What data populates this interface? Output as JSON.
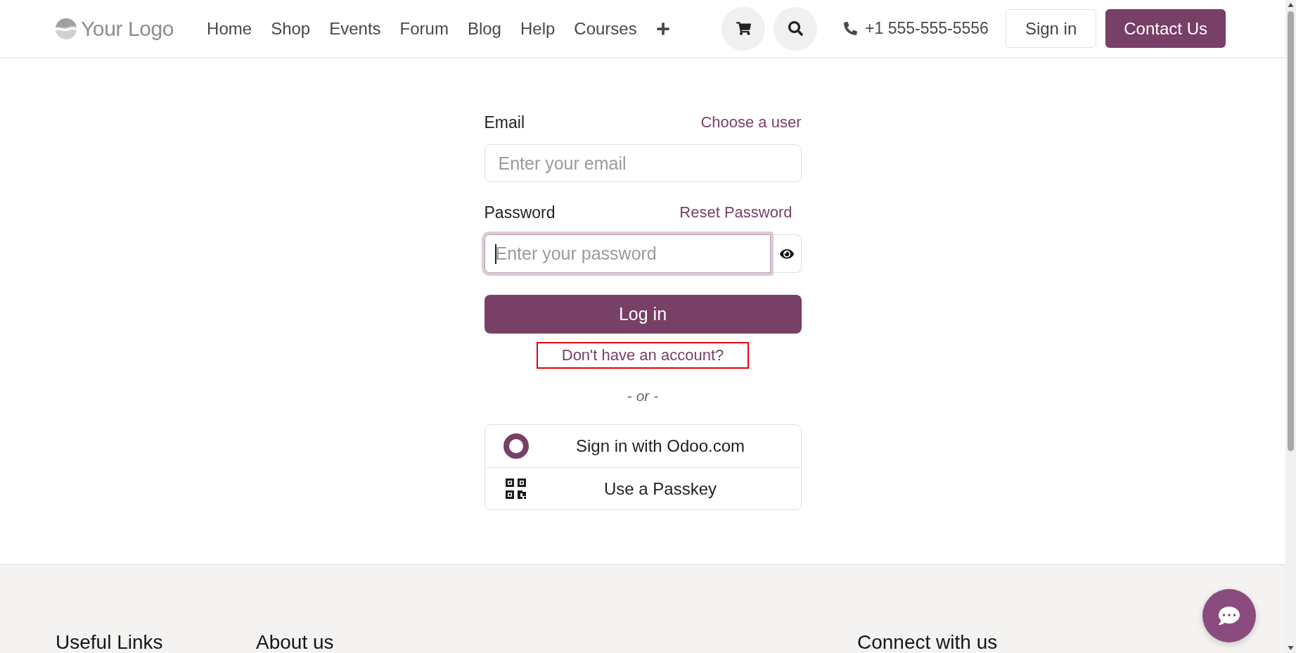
{
  "header": {
    "logo": "Your Logo",
    "nav": [
      "Home",
      "Shop",
      "Events",
      "Forum",
      "Blog",
      "Help",
      "Courses"
    ],
    "phone": "+1 555-555-5556",
    "sign_in": "Sign in",
    "contact": "Contact Us"
  },
  "login_form": {
    "email": {
      "label": "Email",
      "link": "Choose a user",
      "placeholder": "Enter your email"
    },
    "password": {
      "label": "Password",
      "link": "Reset Password",
      "placeholder": "Enter your password",
      "focused": true
    },
    "submit": "Log in",
    "signup_link": {
      "text": "Don't have an account?",
      "highlighted": true
    },
    "separator": "- or -",
    "providers": [
      {
        "kind": "odoo",
        "label": "Sign in with Odoo.com"
      },
      {
        "kind": "passkey",
        "label": "Use a Passkey"
      }
    ]
  },
  "footer": {
    "headings": [
      "Useful Links",
      "About us",
      "Connect with us"
    ]
  }
}
